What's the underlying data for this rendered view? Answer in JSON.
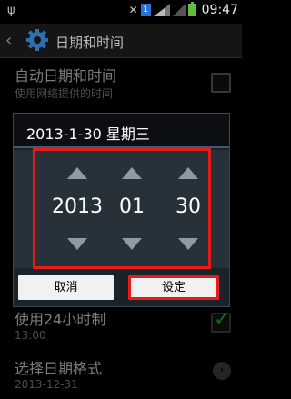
{
  "status_bar": {
    "time": "09:47",
    "sim_label": "1"
  },
  "action_bar": {
    "title": "日期和时间"
  },
  "settings": {
    "auto_datetime": {
      "title": "自动日期和时间",
      "subtitle": "使用网络提供的时间",
      "checked": false
    },
    "use_24h": {
      "title": "使用24小时制",
      "subtitle": "13:00",
      "checked": true
    },
    "date_format": {
      "title": "选择日期格式",
      "subtitle": "2013-12-31"
    }
  },
  "dialog": {
    "title": "2013-1-30 星期三",
    "year": "2013",
    "month": "01",
    "day": "30",
    "cancel_label": "取消",
    "ok_label": "设定"
  },
  "colors": {
    "highlight": "#e81a1a",
    "check": "#2f9a2a",
    "dialog_bg": "#1a222a"
  }
}
